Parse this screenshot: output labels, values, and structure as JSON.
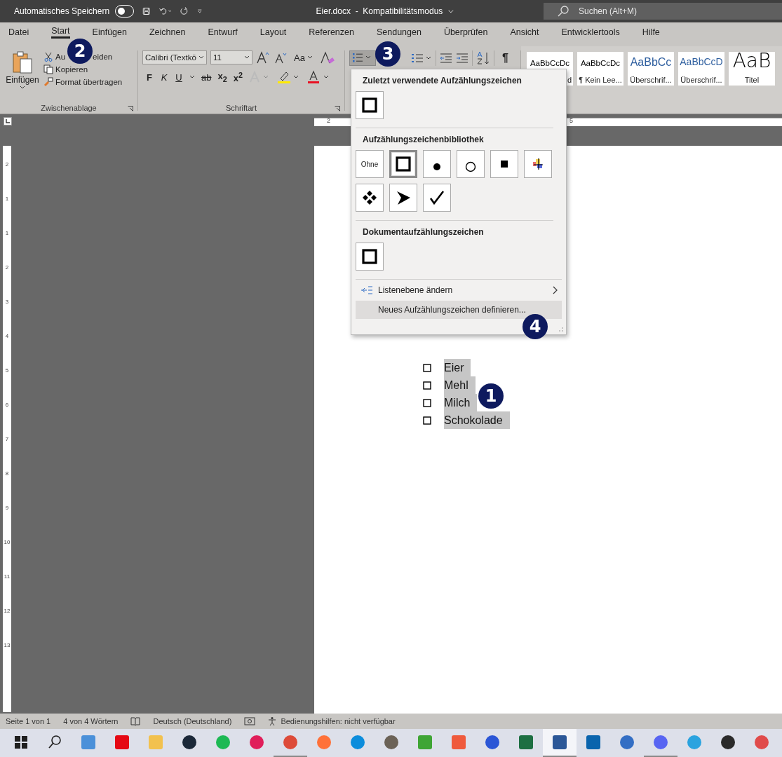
{
  "title_bar": {
    "autosave_label": "Automatisches Speichern",
    "autosave_on": false,
    "doc_title": "Eier.docx  -  Kompatibilitätsmodus",
    "search_placeholder": "Suchen (Alt+M)"
  },
  "tabs": [
    {
      "label": "Datei",
      "selected": false
    },
    {
      "label": "Start",
      "selected": true
    },
    {
      "label": "Einfügen",
      "selected": false
    },
    {
      "label": "Zeichnen",
      "selected": false
    },
    {
      "label": "Entwurf",
      "selected": false
    },
    {
      "label": "Layout",
      "selected": false
    },
    {
      "label": "Referenzen",
      "selected": false
    },
    {
      "label": "Sendungen",
      "selected": false
    },
    {
      "label": "Überprüfen",
      "selected": false
    },
    {
      "label": "Ansicht",
      "selected": false
    },
    {
      "label": "Entwicklertools",
      "selected": false
    },
    {
      "label": "Hilfe",
      "selected": false
    }
  ],
  "clipboard": {
    "paste": "Einfügen",
    "cut_parts": [
      "Au",
      "eiden"
    ],
    "copy": "Kopieren",
    "format_painter": "Format übertragen",
    "group_label": "Zwischenablage"
  },
  "font": {
    "font_name": "Calibri (Textkö",
    "font_size": "11",
    "case_label": "Aa",
    "bold": "F",
    "italic": "K",
    "underline": "U",
    "strikethrough": "ab",
    "subscript": "x$_{2}$",
    "superscript": "x$^{2}$",
    "group_label": "Schriftart"
  },
  "paragraph": {
    "bullets_pressed": true,
    "pilcrow": "¶"
  },
  "styles": [
    {
      "sample": "AaBbCcDc",
      "label": "d",
      "kind": "normal"
    },
    {
      "sample": "AaBbCcDc",
      "label": "¶ Kein Lee...",
      "kind": "normal"
    },
    {
      "sample": "AaBbCc",
      "label": "Überschrif...",
      "kind": "heading1"
    },
    {
      "sample": "AaBbCcD",
      "label": "Überschrif...",
      "kind": "heading2"
    },
    {
      "sample": "AaB",
      "label": "Titel",
      "kind": "title"
    }
  ],
  "bullet_menu": {
    "recent_heading": "Zuletzt verwendete Aufzählungszeichen",
    "recent": [
      {
        "kind": "square",
        "selected": false
      }
    ],
    "library_heading": "Aufzählungszeichenbibliothek",
    "library": [
      {
        "kind": "none",
        "label": "Ohne",
        "selected": false
      },
      {
        "kind": "square",
        "selected": true
      },
      {
        "kind": "dot",
        "selected": false
      },
      {
        "kind": "circle",
        "selected": false
      },
      {
        "kind": "small-square",
        "selected": false
      },
      {
        "kind": "picture",
        "selected": false
      },
      {
        "kind": "diamonds",
        "selected": false
      },
      {
        "kind": "arrow",
        "selected": false
      },
      {
        "kind": "check",
        "selected": false
      }
    ],
    "document_heading": "Dokumentaufzählungszeichen",
    "document": [
      {
        "kind": "square",
        "selected": false
      }
    ],
    "actions": [
      {
        "label": "Listenebene ändern",
        "kind": "submenu",
        "highlighted": false
      },
      {
        "label": "Neues Aufzählungszeichen definieren...",
        "kind": "command",
        "highlighted": true
      }
    ]
  },
  "horizontal_ruler": [
    "2",
    "5"
  ],
  "vertical_ruler": [
    "2",
    "1",
    "1",
    "2",
    "3",
    "4",
    "5",
    "6",
    "7",
    "8",
    "9",
    "10",
    "11",
    "12",
    "13"
  ],
  "document": {
    "list": [
      {
        "text": "Eier",
        "selected": true
      },
      {
        "text": "Mehl",
        "selected": true
      },
      {
        "text": "Milch",
        "selected": true
      },
      {
        "text": "Schokolade",
        "selected": true
      }
    ]
  },
  "callouts": [
    "1",
    "2",
    "3",
    "4"
  ],
  "status_bar": {
    "page": "Seite 1 von 1",
    "words": "4 von 4 Wörtern",
    "language": "Deutsch (Deutschland)",
    "accessibility": "Bedienungshilfen: nicht verfügbar"
  },
  "taskbar": [
    {
      "kind": "windows",
      "running": false
    },
    {
      "kind": "search",
      "running": false
    },
    {
      "kind": "computer",
      "running": false
    },
    {
      "kind": "netflix",
      "running": false
    },
    {
      "kind": "folder",
      "running": false
    },
    {
      "kind": "steam",
      "running": false
    },
    {
      "kind": "spotify",
      "running": false
    },
    {
      "kind": "slack",
      "running": false
    },
    {
      "kind": "chrome",
      "running": true
    },
    {
      "kind": "firefox",
      "running": false
    },
    {
      "kind": "edge",
      "running": false
    },
    {
      "kind": "gimp",
      "running": false
    },
    {
      "kind": "camtasia",
      "running": false
    },
    {
      "kind": "recorder",
      "running": false
    },
    {
      "kind": "audio",
      "running": false
    },
    {
      "kind": "excel",
      "running": false
    },
    {
      "kind": "word",
      "running": true
    },
    {
      "kind": "outlook",
      "running": false
    },
    {
      "kind": "thunderbird",
      "running": false
    },
    {
      "kind": "discord",
      "running": true
    },
    {
      "kind": "telegram",
      "running": false
    },
    {
      "kind": "obs",
      "running": false
    },
    {
      "kind": "paint",
      "running": false
    }
  ]
}
